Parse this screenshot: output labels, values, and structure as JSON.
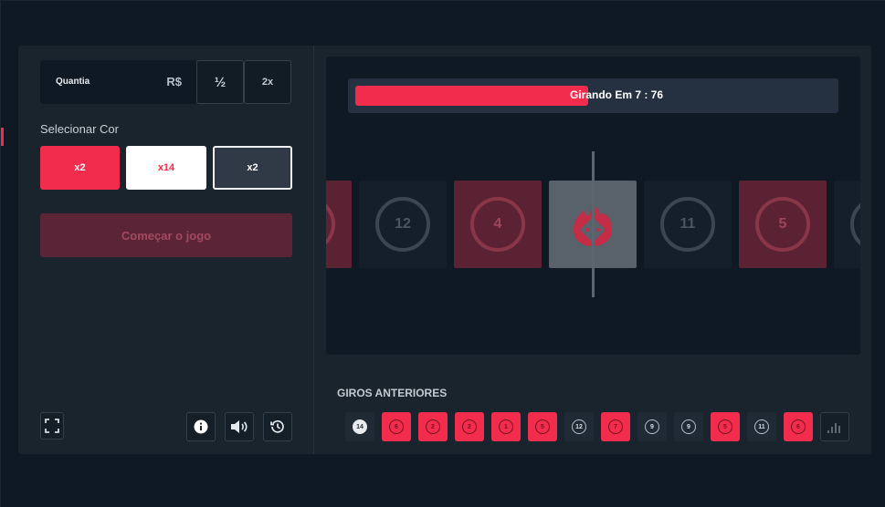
{
  "controls": {
    "amount_label": "Quantia",
    "currency": "R$",
    "half_label": "½",
    "double_label": "2x",
    "select_color_title": "Selecionar Cor",
    "colors": [
      {
        "label": "x2",
        "color": "red"
      },
      {
        "label": "x14",
        "color": "white"
      },
      {
        "label": "x2",
        "color": "black"
      }
    ],
    "start_label": "Começar o jogo",
    "icons": [
      "fullscreen-icon",
      "info-icon",
      "sound-icon",
      "history-icon"
    ]
  },
  "game": {
    "timer_text": "Girando Em 7 : 76",
    "timer_progress": 0.49,
    "tiles": [
      {
        "number": "",
        "color": "red"
      },
      {
        "number": "12",
        "color": "dark"
      },
      {
        "number": "4",
        "color": "red"
      },
      {
        "number": "",
        "color": "white"
      },
      {
        "number": "11",
        "color": "dark"
      },
      {
        "number": "5",
        "color": "red"
      },
      {
        "number": "",
        "color": "dark"
      }
    ]
  },
  "history": {
    "title": "GIROS ANTERIORES",
    "items": [
      {
        "number": "14",
        "color": "white"
      },
      {
        "number": "6",
        "color": "red"
      },
      {
        "number": "2",
        "color": "red"
      },
      {
        "number": "2",
        "color": "red"
      },
      {
        "number": "1",
        "color": "red"
      },
      {
        "number": "5",
        "color": "red"
      },
      {
        "number": "12",
        "color": "dark"
      },
      {
        "number": "7",
        "color": "red"
      },
      {
        "number": "9",
        "color": "dark"
      },
      {
        "number": "9",
        "color": "dark"
      },
      {
        "number": "5",
        "color": "red"
      },
      {
        "number": "11",
        "color": "dark"
      },
      {
        "number": "6",
        "color": "red"
      }
    ]
  },
  "colors": {
    "accent_red": "#f12c4c",
    "background": "#0f1923",
    "panel": "#1a242d"
  }
}
